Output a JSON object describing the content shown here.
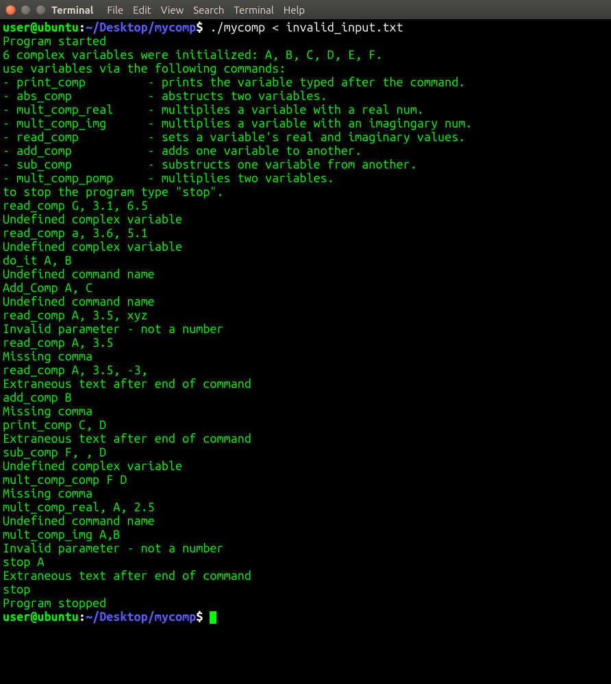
{
  "titlebar": {
    "title": "Terminal"
  },
  "menu": [
    "File",
    "Edit",
    "View",
    "Search",
    "Terminal",
    "Help"
  ],
  "prompt": {
    "userhost": "user@ubuntu",
    "colon": ":",
    "path": "~/Desktop/mycomp",
    "dollar": "$ "
  },
  "cmd1": "./mycomp < invalid_input.txt",
  "output": [
    "Program started",
    "6 complex variables were initialized: A, B, C, D, E, F.",
    "use variables via the following commands:",
    "- print_comp         - prints the variable typed after the command.",
    "- abs_comp           - abstructs two variables.",
    "- mult_comp_real     - multiplies a variable with a real num.",
    "- mult_comp_img      - multiplies a variable with an imagingary num.",
    "- read_comp          - sets a variable's real and imaginary values.",
    "- add_comp           - adds one variable to another.",
    "- sub_comp           - substructs one variable from another.",
    "- mult_comp_pomp     - multiplies two variables.",
    "to stop the program type \"stop\".",
    "read_comp G, 3.1, 6.5",
    "Undefined complex variable",
    "read_comp a, 3.6, 5.1",
    "Undefined complex variable",
    "do_it A, B",
    "Undefined command name",
    "Add_Comp A, C",
    "Undefined command name",
    "read_comp A, 3.5, xyz",
    "Invalid parameter - not a number",
    "read_comp A, 3.5",
    "Missing comma",
    "read_comp A, 3.5, -3,",
    "Extraneous text after end of command",
    "add_comp B",
    "Missing comma",
    "print_comp C, D",
    "Extraneous text after end of command",
    "sub_comp F, , D",
    "Undefined complex variable",
    "mult_comp_comp F D",
    "Missing comma",
    "mult_comp_real, A, 2.5",
    "Undefined command name",
    "mult_comp_img A,B",
    "Invalid parameter - not a number",
    "stop A",
    "Extraneous text after end of command",
    "stop",
    "Program stopped"
  ],
  "cmd2": ""
}
